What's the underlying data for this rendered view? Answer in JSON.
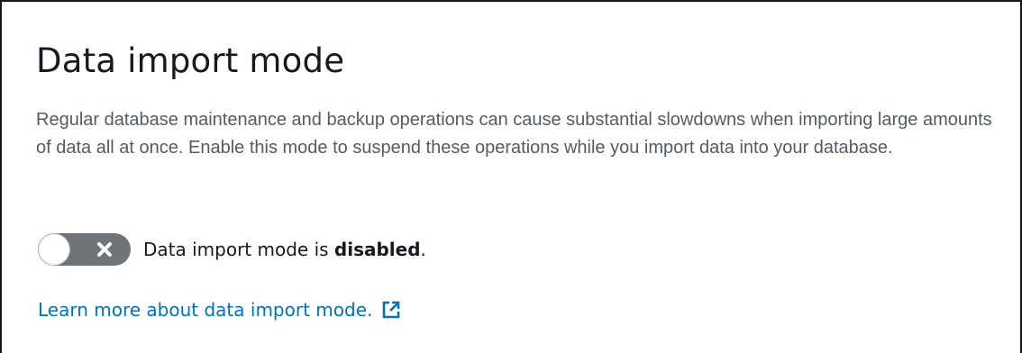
{
  "section": {
    "title": "Data import mode",
    "description": "Regular database maintenance and backup operations can cause substantial slowdowns when importing large amounts of data all at once. Enable this mode to suspend these operations while you import data into your database."
  },
  "toggle": {
    "state": "off",
    "icon": "close-icon",
    "status_prefix": "Data import mode is ",
    "status_value": "disabled",
    "status_suffix": "."
  },
  "link": {
    "label": "Learn more about data import mode.",
    "icon": "external-link-icon"
  },
  "colors": {
    "border": "#16191f",
    "title": "#16191f",
    "description": "#545b64",
    "toggle_off": "#6f7479",
    "link": "#0073bb"
  }
}
